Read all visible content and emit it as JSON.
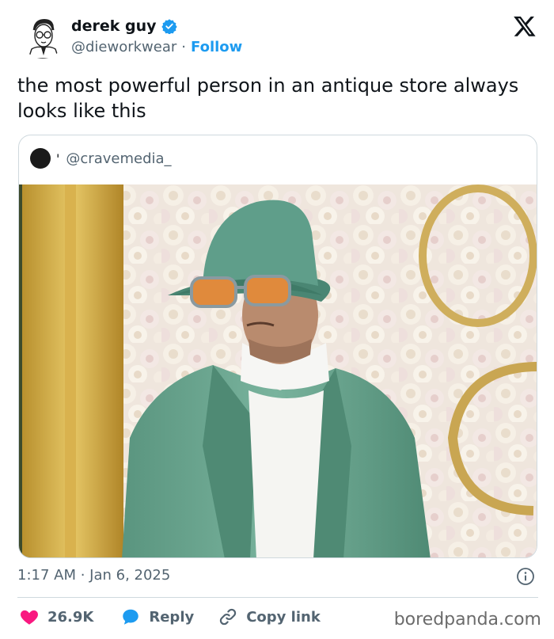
{
  "author": {
    "display_name": "derek guy",
    "handle": "@dieworkwear",
    "separator": "·",
    "follow_label": "Follow"
  },
  "tweet": {
    "text": "the most powerful person in an antique store always looks like this"
  },
  "quote": {
    "handle": "@cravemedia_",
    "tick": "'"
  },
  "meta": {
    "timestamp": "1:17 AM · Jan 6, 2025"
  },
  "actions": {
    "likes": "26.9K",
    "reply_label": "Reply",
    "copy_link_label": "Copy link"
  },
  "watermark": "boredpanda.com",
  "colors": {
    "accent": "#1d9bf0",
    "like": "#f91880",
    "muted": "#536471",
    "jacket": "#6fa893",
    "hat": "#5f9e8a"
  }
}
